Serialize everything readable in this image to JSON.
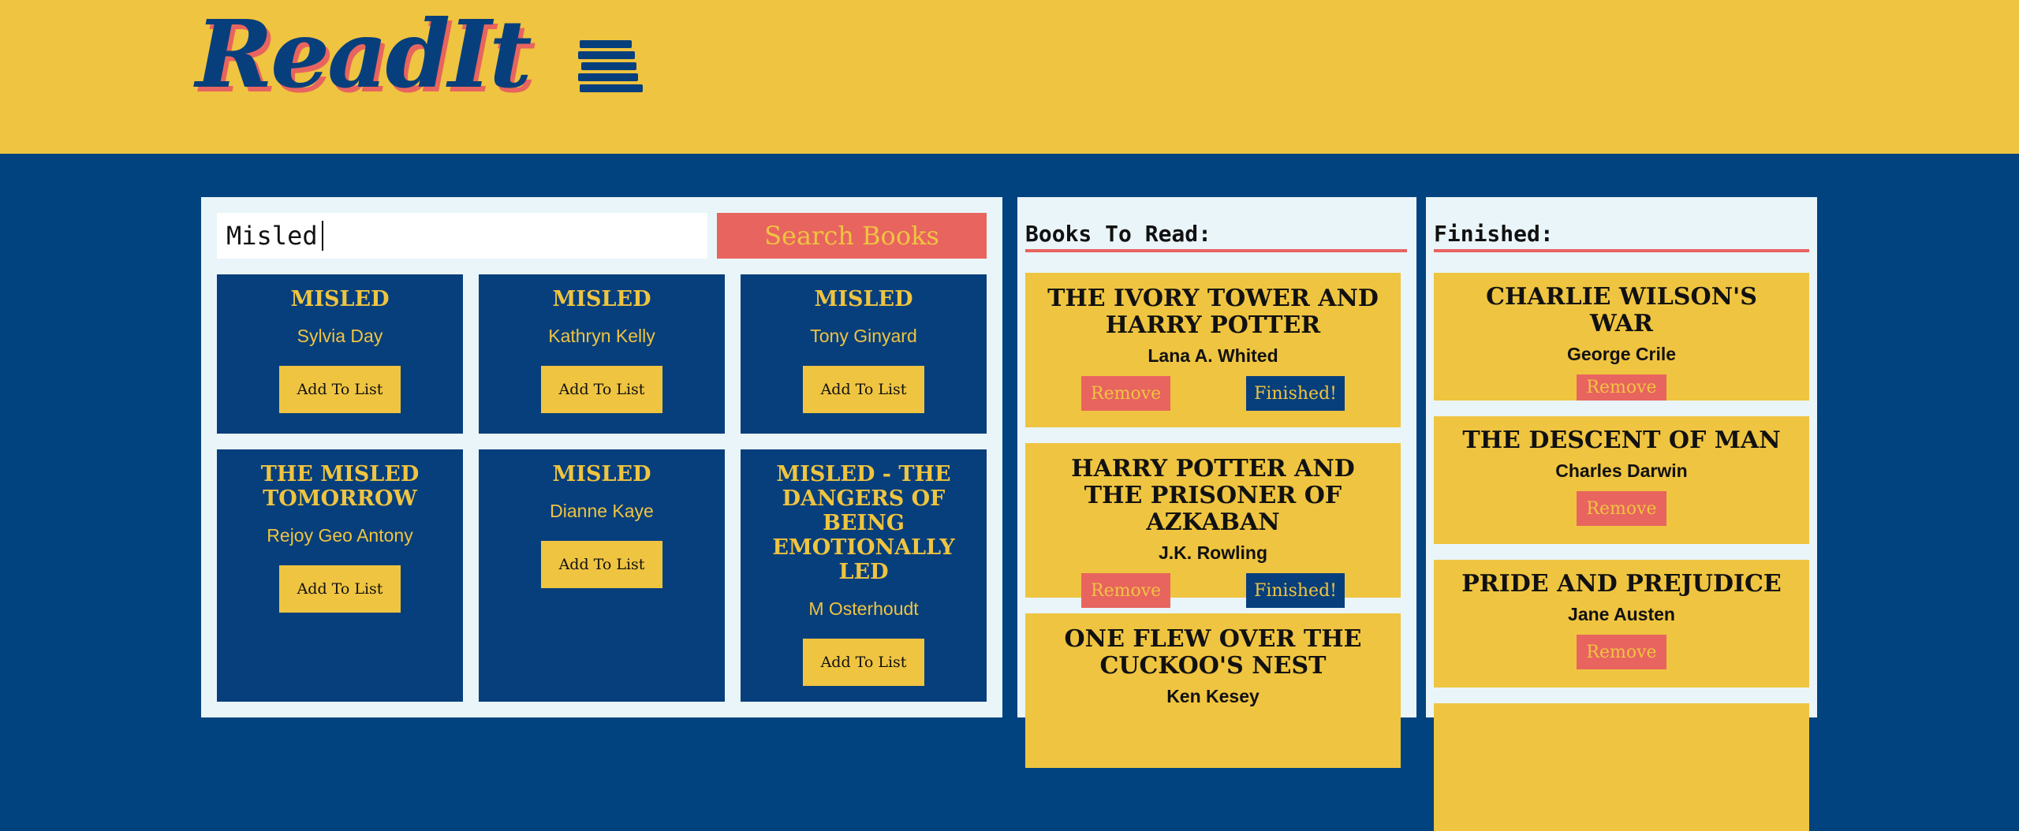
{
  "app": {
    "logo_text": "ReadIt",
    "logo_icon": "book-stack-icon"
  },
  "colors": {
    "header_bg": "#efc440",
    "page_bg": "#00437f",
    "navy": "#073f7c",
    "coral": "#e8645f",
    "panel_bg": "#eaf5f9"
  },
  "search": {
    "value": "Misled",
    "button_label": "Search Books"
  },
  "results": [
    {
      "title": "MISLED",
      "author": "Sylvia Day",
      "button": "Add To List"
    },
    {
      "title": "MISLED",
      "author": "Kathryn Kelly",
      "button": "Add To List"
    },
    {
      "title": "MISLED",
      "author": "Tony Ginyard",
      "button": "Add To List"
    },
    {
      "title": "THE MISLED TOMORROW",
      "author": "Rejoy Geo Antony",
      "button": "Add To List"
    },
    {
      "title": "MISLED",
      "author": "Dianne Kaye",
      "button": "Add To List"
    },
    {
      "title": "MISLED - THE DANGERS OF BEING EMOTIONALLY LED",
      "author": "M Osterhoudt",
      "button": "Add To List"
    }
  ],
  "to_read": {
    "heading": "Books To Read:",
    "remove_label": "Remove",
    "finished_label": "Finished!",
    "books": [
      {
        "title": "THE IVORY TOWER AND HARRY POTTER",
        "author": "Lana A. Whited"
      },
      {
        "title": "HARRY POTTER AND THE PRISONER OF AZKABAN",
        "author": "J.K. Rowling"
      },
      {
        "title": "ONE FLEW OVER THE CUCKOO'S NEST",
        "author": "Ken Kesey"
      }
    ]
  },
  "finished": {
    "heading": "Finished:",
    "remove_label": "Remove",
    "books": [
      {
        "title": "CHARLIE WILSON'S WAR",
        "author": "George Crile"
      },
      {
        "title": "THE DESCENT OF MAN",
        "author": "Charles Darwin"
      },
      {
        "title": "PRIDE AND PREJUDICE",
        "author": "Jane Austen"
      },
      {
        "title": "",
        "author": ""
      }
    ]
  }
}
